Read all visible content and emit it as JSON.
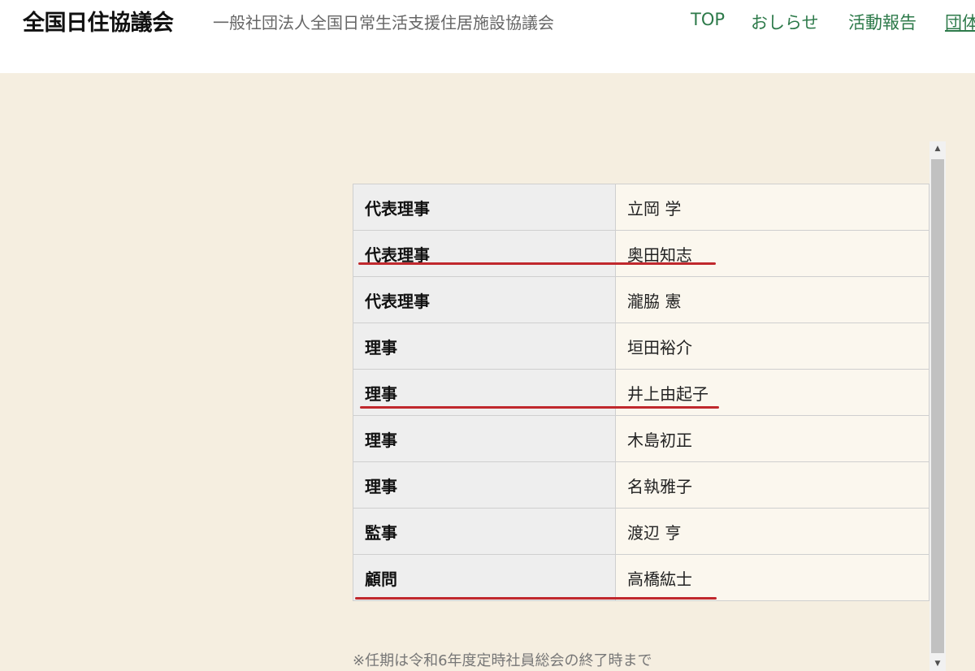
{
  "header": {
    "title": "全国日住協議会",
    "subtitle": "一般社団法人全国日常生活支援住居施設協議会",
    "nav": [
      {
        "label": "TOP"
      },
      {
        "label": "おしらせ"
      },
      {
        "label": "活動報告"
      },
      {
        "label": "団体"
      }
    ]
  },
  "officers": [
    {
      "role": "代表理事",
      "name": "立岡 学"
    },
    {
      "role": "代表理事",
      "name": "奥田知志"
    },
    {
      "role": "代表理事",
      "name": "瀧脇 憲"
    },
    {
      "role": "理事",
      "name": "垣田裕介"
    },
    {
      "role": "理事",
      "name": "井上由起子"
    },
    {
      "role": "理事",
      "name": "木島初正"
    },
    {
      "role": "理事",
      "name": "名執雅子"
    },
    {
      "role": "監事",
      "name": "渡辺 亨"
    },
    {
      "role": "顧問",
      "name": "高橋紘士"
    }
  ],
  "note": "※任期は令和6年度定時社員総会の終了時まで",
  "scrollbar": {
    "up_icon": "triangle-up-icon",
    "down_icon": "triangle-down-icon"
  },
  "colors": {
    "nav_text": "#2d7a4a",
    "content_background": "#f5eee0",
    "annotation_underline": "#c0282d"
  }
}
